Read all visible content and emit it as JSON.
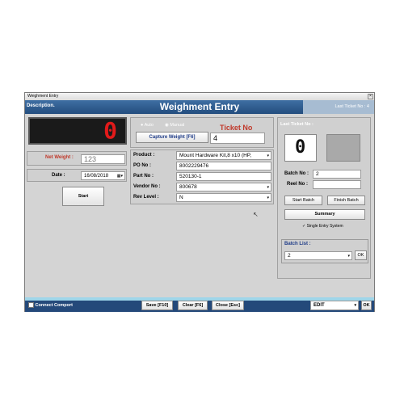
{
  "window": {
    "title": "Weighment Entry",
    "close_glyph": "×"
  },
  "header": {
    "left": "Description.",
    "title": "Weighment Entry",
    "right": "Last Ticket No :  4"
  },
  "display": {
    "value": "0",
    "color": "#e21a1a"
  },
  "weight": {
    "label": "Net Weight :",
    "value": "123"
  },
  "date": {
    "label": "Date :",
    "value": "16/08/2018"
  },
  "start": {
    "label": "Start"
  },
  "mode": {
    "auto": "Auto",
    "manual": "Manual"
  },
  "capture": {
    "label": "Capture Weight [F6]"
  },
  "ticket": {
    "label": "Ticket No",
    "value": "4"
  },
  "form": {
    "product_label": "Product :",
    "product_value": "Mount Hardware Kit,8 x10  (HP,",
    "po_label": "PO No :",
    "po_value": "8002229476",
    "part_label": "Part No :",
    "part_value": "520130-1",
    "vendor_label": "Vendor No :",
    "vendor_value": "800678",
    "rev_label": "Rev Level :",
    "rev_value": "N"
  },
  "right": {
    "last_ticket_label": "Last Ticket No :",
    "last_ticket_value": "0",
    "batch_label": "Batch No :",
    "batch_value": "2",
    "reel_label": "Reel No :",
    "reel_value": "",
    "start_batch": "Start Batch",
    "finish_batch": "Finish Batch",
    "summary": "Summary",
    "single_entry": "Single Entry System",
    "batch_list_label": "Batch List :",
    "batch_list_value": "2",
    "ok": "OK"
  },
  "footer": {
    "connect": "Connect Comport",
    "save": "Save [F10]",
    "clear": "Clear [F6]",
    "close": "Close [Esc]",
    "mode_value": "EDIT",
    "ok": "OK"
  }
}
